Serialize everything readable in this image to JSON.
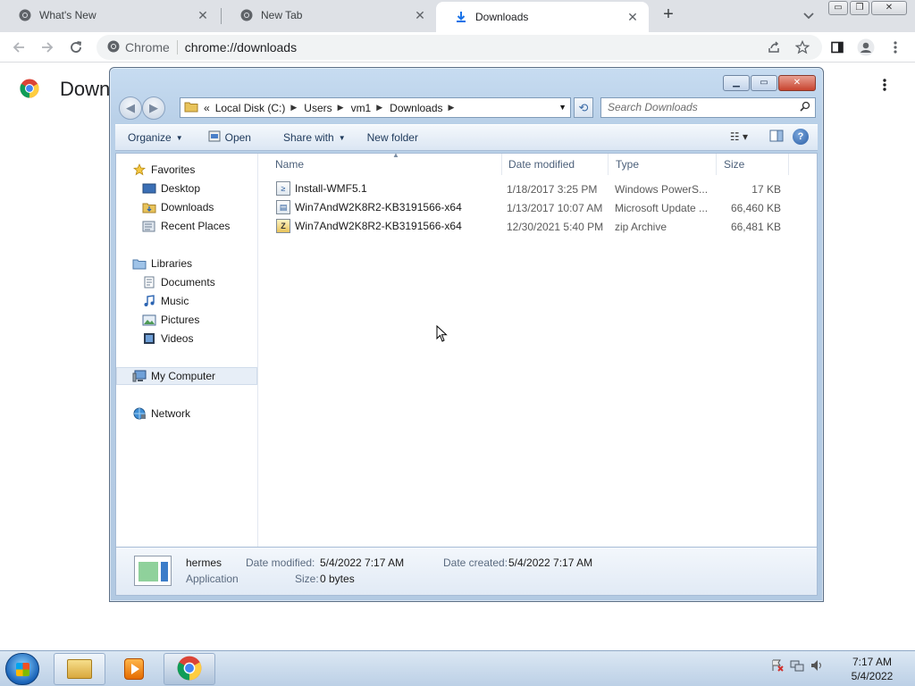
{
  "browser": {
    "tabs": [
      {
        "title": "What's New",
        "icon": "chrome-icon",
        "active": false
      },
      {
        "title": "New Tab",
        "icon": "chrome-icon",
        "active": false
      },
      {
        "title": "Downloads",
        "icon": "download-icon",
        "active": true
      }
    ],
    "new_tab_symbol": "+",
    "tab_close_symbol": "✕",
    "window_controls": {
      "minimize": "▭",
      "restore": "❐",
      "close": "✕"
    },
    "omnibox": {
      "site_label": "Chrome",
      "url": "chrome://downloads"
    },
    "accent_color": "#1a73e8"
  },
  "downloads_page": {
    "title": "Downloads"
  },
  "explorer": {
    "breadcrumb": {
      "overflow": "«",
      "items": [
        "Local Disk (C:)",
        "Users",
        "vm1",
        "Downloads"
      ]
    },
    "search_placeholder": "Search Downloads",
    "commands": {
      "organize": "Organize",
      "open": "Open",
      "share_with": "Share with",
      "new_folder": "New folder"
    },
    "nav": {
      "favorites": "Favorites",
      "desktop": "Desktop",
      "downloads": "Downloads",
      "recent_places": "Recent Places",
      "libraries": "Libraries",
      "documents": "Documents",
      "music": "Music",
      "pictures": "Pictures",
      "videos": "Videos",
      "my_computer": "My Computer",
      "network": "Network"
    },
    "columns": {
      "name": "Name",
      "date_modified": "Date modified",
      "type": "Type",
      "size": "Size"
    },
    "files": [
      {
        "name": "Install-WMF5.1",
        "date": "1/18/2017 3:25 PM",
        "type": "Windows PowerS...",
        "size": "17 KB",
        "icon": "powershell-script-icon"
      },
      {
        "name": "Win7AndW2K8R2-KB3191566-x64",
        "date": "1/13/2017 10:07 AM",
        "type": "Microsoft Update ...",
        "size": "66,460 KB",
        "icon": "update-package-icon"
      },
      {
        "name": "Win7AndW2K8R2-KB3191566-x64",
        "date": "12/30/2021 5:40 PM",
        "type": "zip Archive",
        "size": "66,481 KB",
        "icon": "zip-archive-icon"
      }
    ],
    "details": {
      "name": "hermes",
      "kind": "Application",
      "date_modified_label": "Date modified:",
      "date_modified": "5/4/2022 7:17 AM",
      "date_created_label": "Date created:",
      "date_created": "5/4/2022 7:17 AM",
      "size_label": "Size:",
      "size": "0 bytes"
    }
  },
  "taskbar": {
    "time": "7:17 AM",
    "date": "5/4/2022"
  }
}
